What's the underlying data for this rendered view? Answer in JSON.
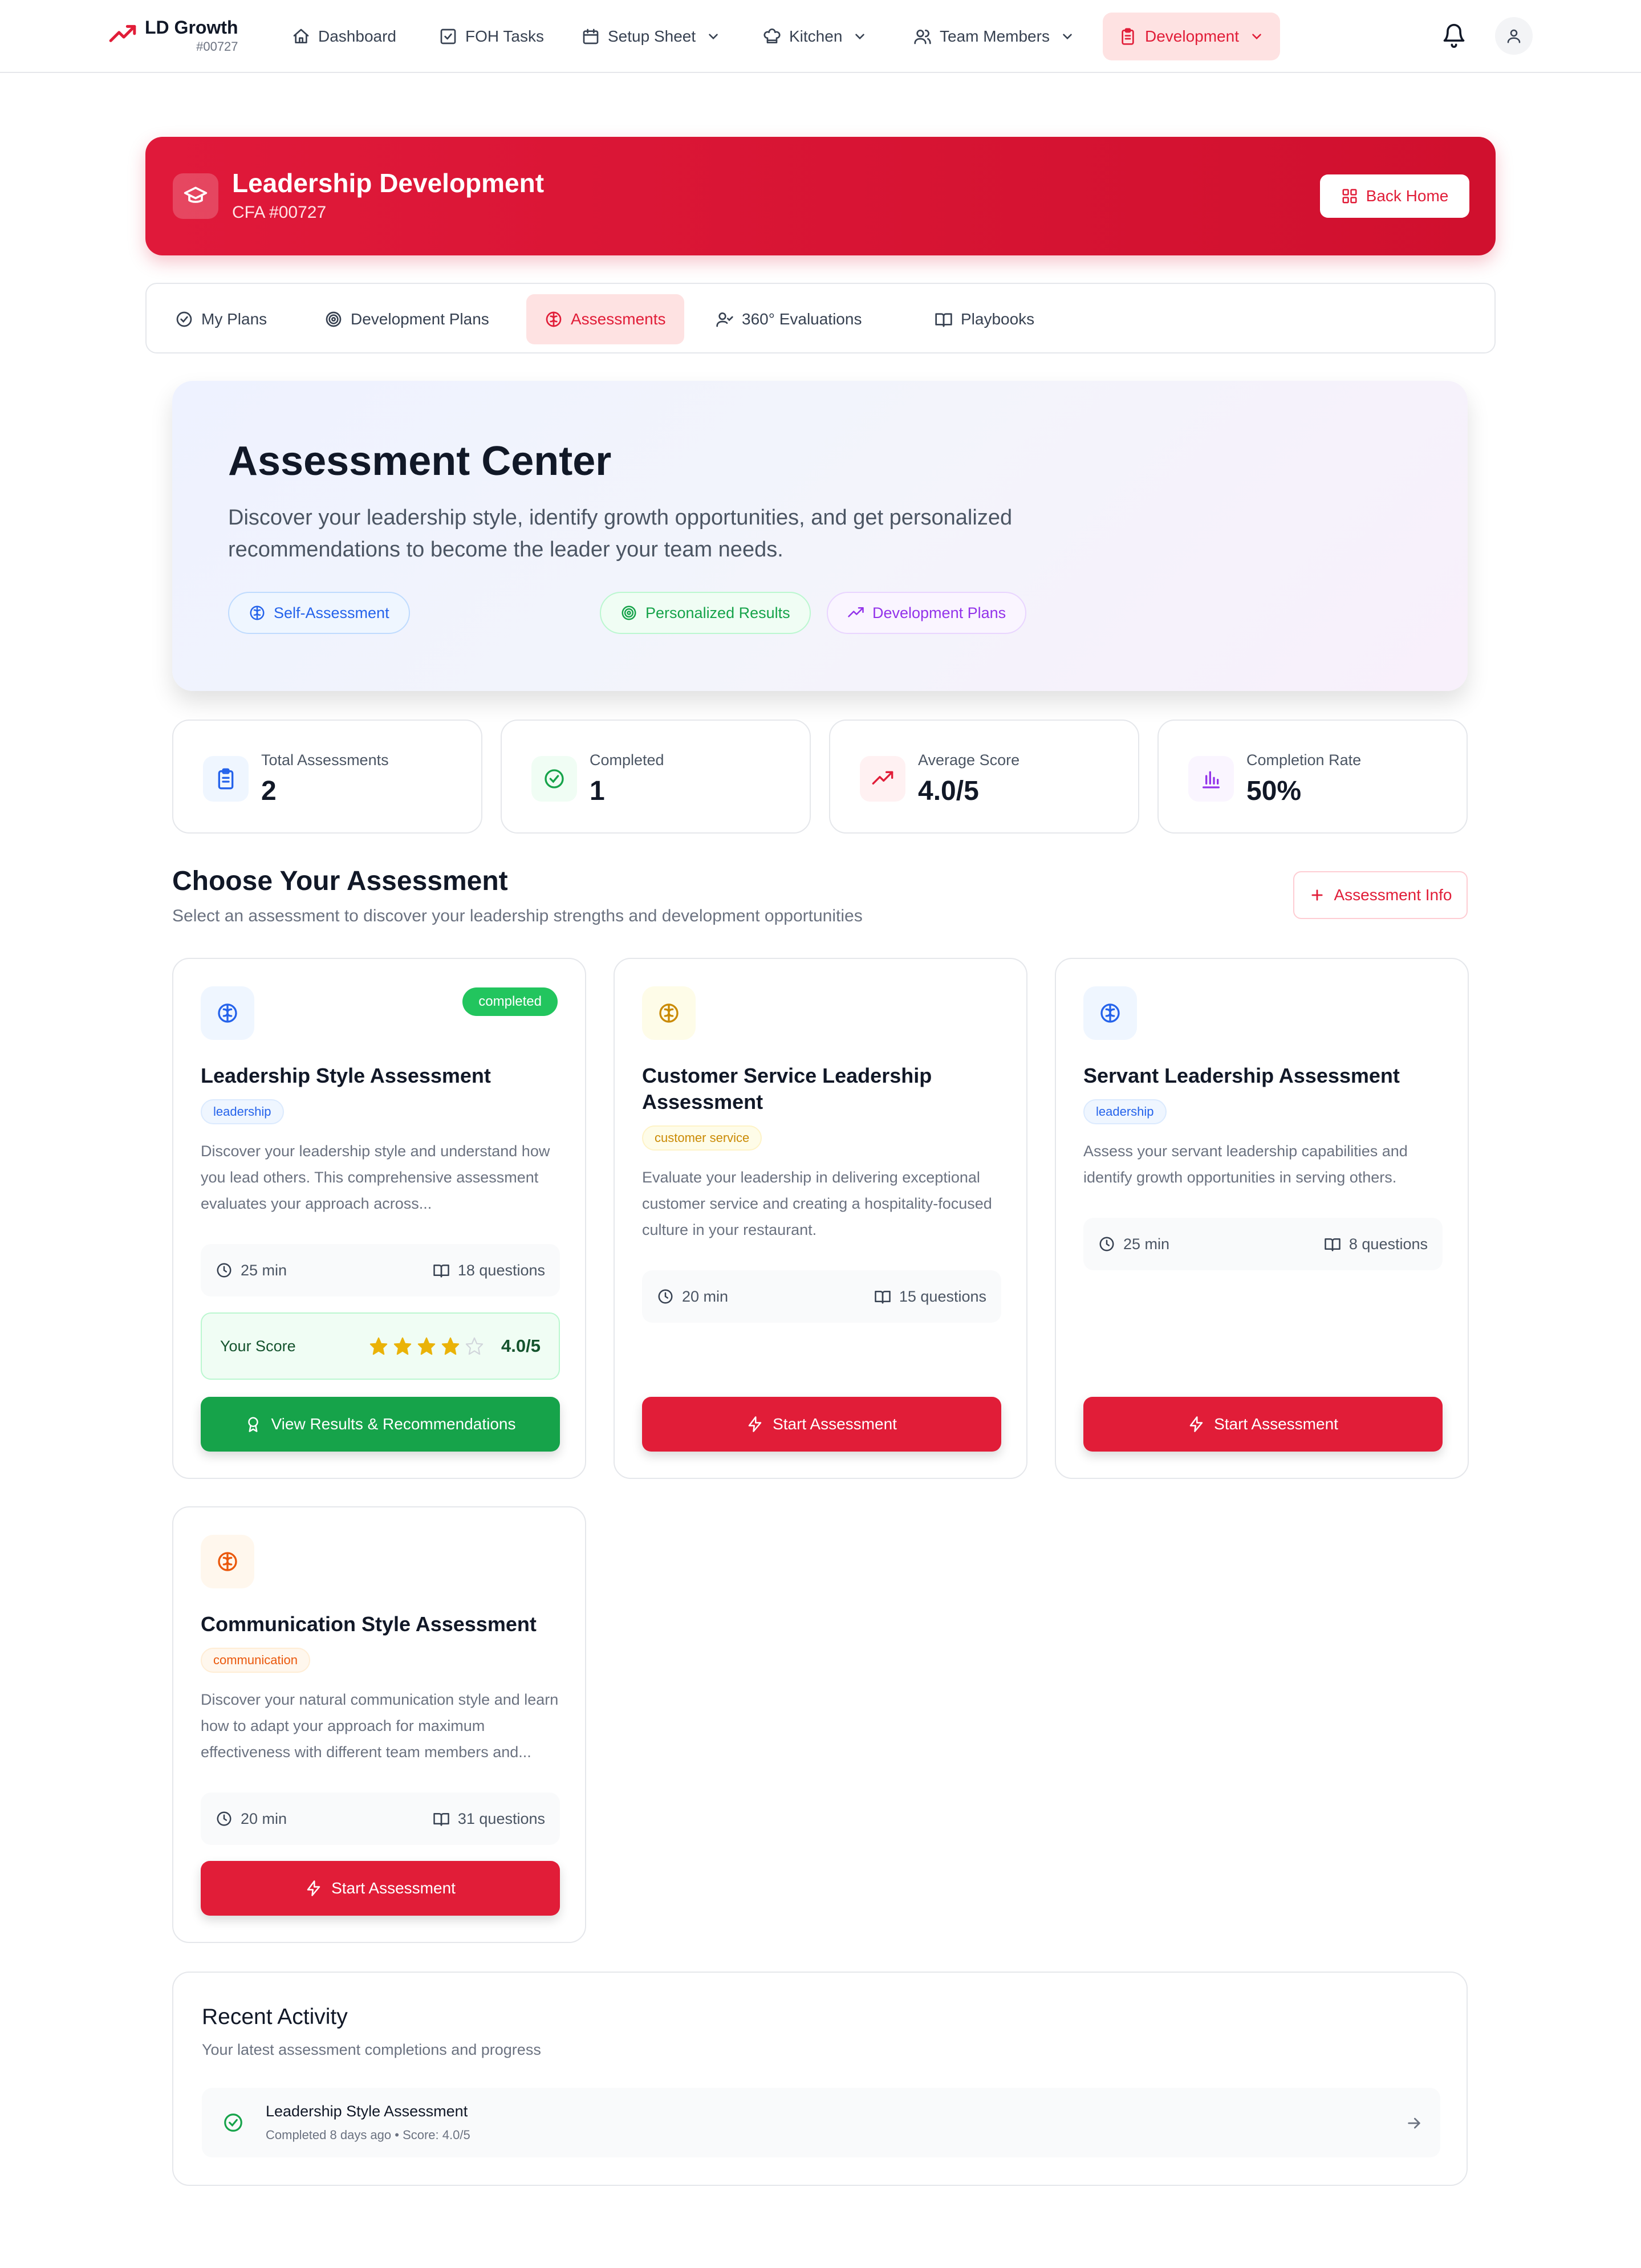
{
  "app": {
    "brand_name": "LD Growth",
    "brand_id": "#00727",
    "nav": [
      {
        "label": "Dashboard",
        "icon": "home-icon"
      },
      {
        "label": "FOH Tasks",
        "icon": "checkbox-icon"
      },
      {
        "label": "Setup Sheet",
        "icon": "calendar-icon",
        "dropdown": true
      },
      {
        "label": "Kitchen",
        "icon": "chef-hat-icon",
        "dropdown": true
      },
      {
        "label": "Team Members",
        "icon": "users-icon",
        "dropdown": true
      },
      {
        "label": "Development",
        "icon": "clipboard-icon",
        "dropdown": true,
        "active": true
      }
    ]
  },
  "banner": {
    "title": "Leadership Development",
    "subtitle": "CFA #00727",
    "back_label": "Back Home"
  },
  "tabs": [
    {
      "label": "My Plans",
      "icon": "check-circle-icon"
    },
    {
      "label": "Development Plans",
      "icon": "target-icon"
    },
    {
      "label": "Assessments",
      "icon": "brain-icon",
      "active": true
    },
    {
      "label": "360° Evaluations",
      "icon": "user-check-icon"
    },
    {
      "label": "Playbooks",
      "icon": "book-open-icon"
    }
  ],
  "hero": {
    "title": "Assessment Center",
    "description": "Discover your leadership style, identify growth opportunities, and get personalized recommendations to become the leader your team needs.",
    "pills": [
      "Self-Assessment",
      "Personalized Results",
      "Development Plans"
    ]
  },
  "stats": [
    {
      "label": "Total Assessments",
      "value": "2",
      "icon": "clipboard-icon"
    },
    {
      "label": "Completed",
      "value": "1",
      "icon": "check-circle-icon"
    },
    {
      "label": "Average Score",
      "value": "4.0/5",
      "icon": "trending-up-icon"
    },
    {
      "label": "Completion Rate",
      "value": "50%",
      "icon": "bar-chart-icon"
    }
  ],
  "section": {
    "title": "Choose Your Assessment",
    "subtitle": "Select an assessment to discover your leadership strengths and development opportunities",
    "info_label": "Assessment Info"
  },
  "cards": [
    {
      "title": "Leadership Style Assessment",
      "status": "completed",
      "tag": "leadership",
      "description": "Discover your leadership style and understand how you lead others. This comprehensive assessment evaluates your approach across...",
      "time": "25 min",
      "questions": "18 questions",
      "score_label": "Your Score",
      "score": "4.0/5",
      "rating": 4,
      "button": "View Results & Recommendations"
    },
    {
      "title": "Customer Service Leadership Assessment",
      "tag": "customer service",
      "description": "Evaluate your leadership in delivering exceptional customer service and creating a hospitality-focused culture in your restaurant.",
      "time": "20 min",
      "questions": "15 questions",
      "button": "Start Assessment"
    },
    {
      "title": "Servant Leadership Assessment",
      "tag": "leadership",
      "description": "Assess your servant leadership capabilities and identify growth opportunities in serving others.",
      "time": "25 min",
      "questions": "8 questions",
      "button": "Start Assessment"
    },
    {
      "title": "Communication Style Assessment",
      "tag": "communication",
      "description": "Discover your natural communication style and learn how to adapt your approach for maximum effectiveness with different team members and...",
      "time": "20 min",
      "questions": "31 questions",
      "button": "Start Assessment"
    }
  ],
  "recent": {
    "title": "Recent Activity",
    "subtitle": "Your latest assessment completions and progress",
    "items": [
      {
        "title": "Leadership Style Assessment",
        "detail": "Completed 8 days ago • Score: 4.0/5"
      }
    ]
  },
  "colors": {
    "accent": "#e11d38",
    "success": "#16a34a",
    "star": "#eab308"
  }
}
